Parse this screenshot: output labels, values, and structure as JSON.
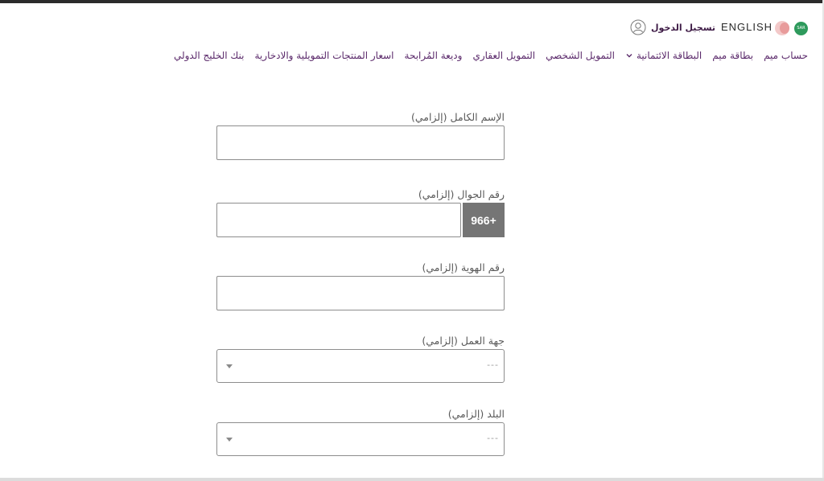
{
  "header": {
    "logo_text": "SAR",
    "lang_link": "ENGLISH",
    "login": "تسجيل الدخول"
  },
  "nav": [
    "حساب ميم",
    "بطاقة ميم",
    "البطاقة الائتمانية",
    "التمويل الشخصي",
    "التمويل العقاري",
    "وديعة المُرابحة",
    "اسعار المنتجات التمويلية والادخارية",
    "بنك الخليج الدولي"
  ],
  "form": {
    "full_name_label": "الإسم الكامل (إلزامي)",
    "mobile_label": "رقم الجوال (إلزامي)",
    "mobile_prefix": "966+",
    "id_label": "رقم الهوية (إلزامي)",
    "employer_label": "جهة العمل (إلزامي)",
    "employer_placeholder": "---",
    "country_label": "البلد (إلزامي)",
    "country_placeholder": "---"
  },
  "colors": {
    "nav_text": "#5b2a6b",
    "prefix_bg": "#757575",
    "input_border": "#8d8d8d"
  }
}
